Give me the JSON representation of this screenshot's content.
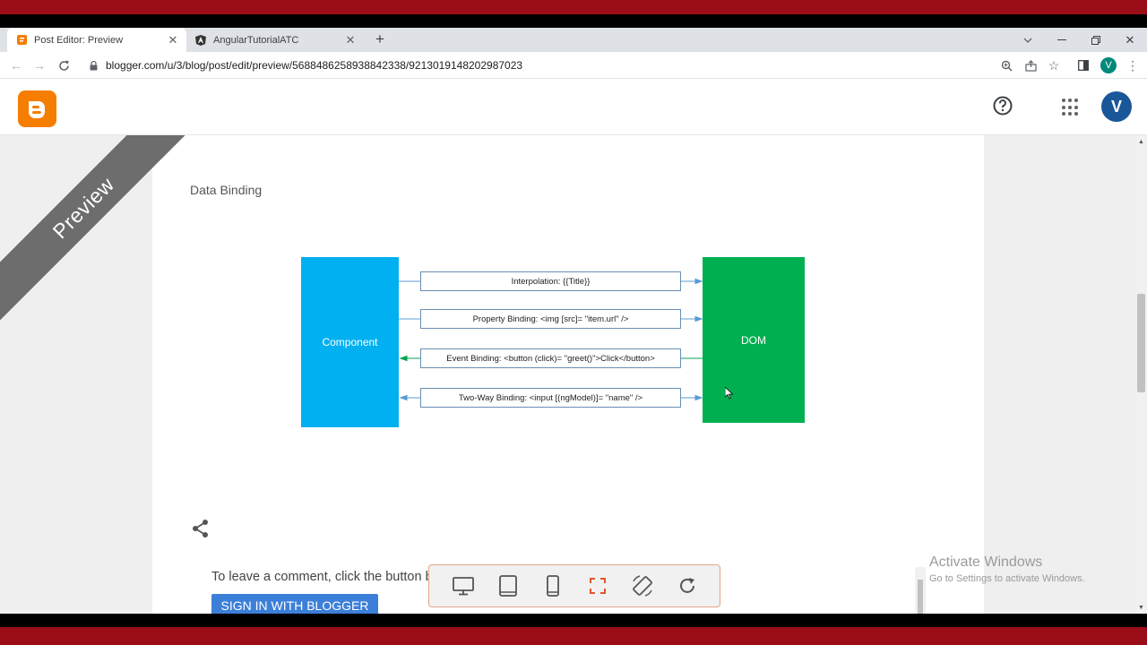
{
  "browser": {
    "tabs": [
      {
        "title": "Post Editor: Preview",
        "active": true
      },
      {
        "title": "AngularTutorialATC",
        "active": false
      }
    ],
    "new_tab": "+",
    "url": "blogger.com/u/3/blog/post/edit/preview/5688486258938842338/9213019148202987023",
    "profile_initial": "V"
  },
  "blogger": {
    "avatar_initial": "V",
    "brand_color": "#f57d00"
  },
  "post": {
    "ribbon": "Preview",
    "title": "Data Binding",
    "diagram": {
      "left_block": "Component",
      "right_block": "DOM",
      "rows": [
        {
          "label": "Interpolation: {{Title}}",
          "direction": "to-dom"
        },
        {
          "label": "Property Binding: <img [src]= \"item.url\" />",
          "direction": "to-dom"
        },
        {
          "label": "Event Binding: <button (click)= \"greet()\">Click</button>",
          "direction": "to-component"
        },
        {
          "label": "Two-Way Binding: <input [(ngModel)]= \"name\" />",
          "direction": "both"
        }
      ],
      "colors": {
        "component": "#00b0f0",
        "dom": "#00b050",
        "arrow_blue": "#5b9bd5",
        "arrow_green": "#00a550"
      }
    },
    "comment_prompt": "To leave a comment, click the button below to sign in with Blogger.",
    "signin_label": "SIGN IN WITH BLOGGER"
  },
  "preview_bar": {
    "buttons": [
      "desktop-icon",
      "tablet-icon",
      "mobile-icon",
      "fullscreen-icon",
      "rotate-icon",
      "refresh-icon"
    ]
  },
  "watermark": {
    "line1": "Activate Windows",
    "line2": "Go to Settings to activate Windows."
  }
}
